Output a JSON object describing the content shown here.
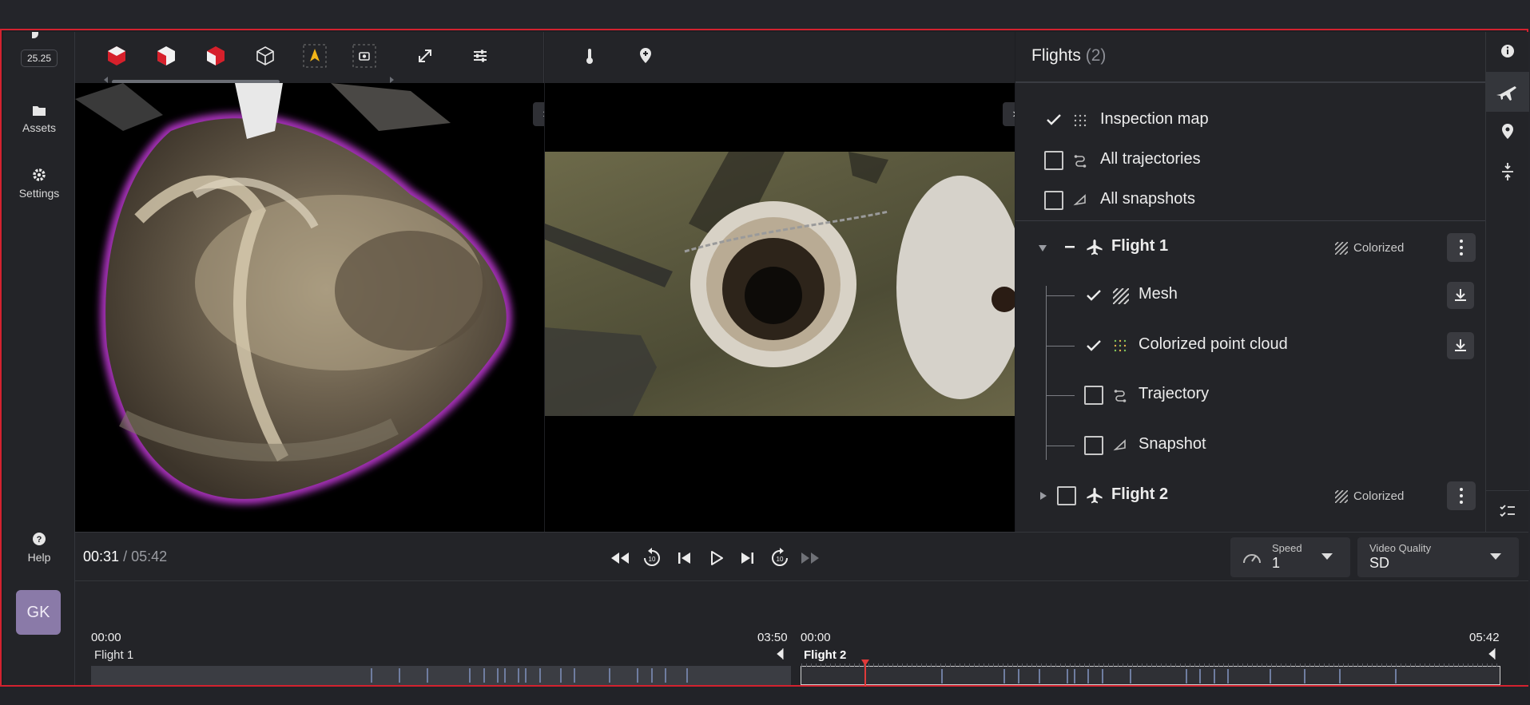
{
  "app": {
    "version": "25.25"
  },
  "left_nav": {
    "assets_label": "Assets",
    "settings_label": "Settings",
    "help_label": "Help",
    "user_initials": "GK"
  },
  "toolbar_icons": [
    "cube-front-red-icon",
    "cube-side-red-icon",
    "cube-top-red-icon",
    "cube-outline-icon",
    "north-arrow-icon",
    "screenshot-icon",
    "fullscreen-icon",
    "sliders-icon"
  ],
  "right_toolbar_icons": [
    "thermometer-icon",
    "add-location-icon"
  ],
  "flights_panel": {
    "title": "Flights",
    "count": "(2)",
    "layers": [
      {
        "label": "Inspection map",
        "checked": true,
        "icon": "point-grid-icon"
      },
      {
        "label": "All trajectories",
        "checked": false,
        "icon": "trajectory-icon"
      },
      {
        "label": "All snapshots",
        "checked": false,
        "icon": "snapshot-icon"
      }
    ],
    "flights": [
      {
        "name": "Flight 1",
        "badge": "Colorized",
        "expanded": true,
        "children": [
          {
            "label": "Mesh",
            "checked": true,
            "downloadable": true
          },
          {
            "label": "Colorized point cloud",
            "checked": true,
            "downloadable": true
          },
          {
            "label": "Trajectory",
            "checked": false,
            "downloadable": false
          },
          {
            "label": "Snapshot",
            "checked": false,
            "downloadable": false
          }
        ]
      },
      {
        "name": "Flight 2",
        "badge": "Colorized",
        "expanded": false
      }
    ]
  },
  "right_rail_icons": [
    "info-icon",
    "airplane-icon",
    "location-pin-icon",
    "collapse-vertical-icon",
    "checklist-icon"
  ],
  "player": {
    "current_time": "00:31",
    "total_time": "/ 05:42",
    "speed_caption": "Speed",
    "speed_value": "1",
    "quality_caption": "Video Quality",
    "quality_value": "SD"
  },
  "timeline": {
    "segments": [
      {
        "name": "Flight 1",
        "start": "00:00",
        "end": "03:50",
        "selected": false
      },
      {
        "name": "Flight 2",
        "start": "00:00",
        "end": "05:42",
        "selected": true,
        "playhead_fraction": 0.091
      }
    ]
  },
  "colors": {
    "accent_red": "#d3222f",
    "avatar_bg": "#8a7aa8",
    "mesh_glow": "#c13bd6",
    "background": "#1e1f23"
  }
}
